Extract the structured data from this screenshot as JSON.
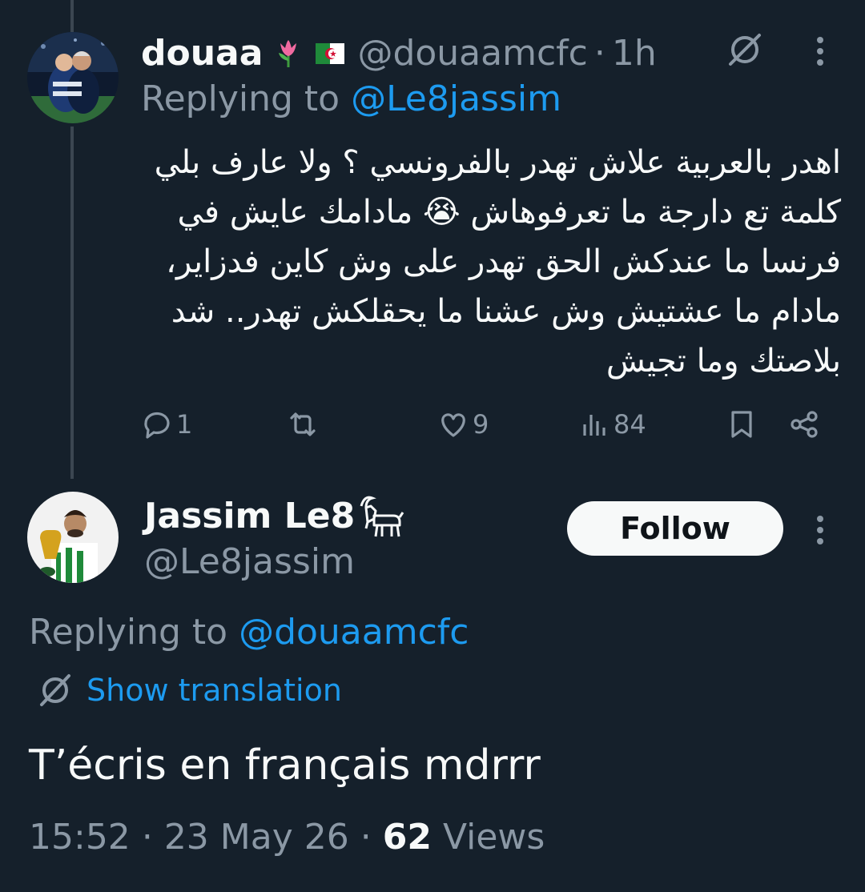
{
  "tweet1": {
    "display_name": "douaa",
    "emojis": [
      "tulip-emoji",
      "algeria-flag-emoji"
    ],
    "handle": "@douaamcfc",
    "separator": "·",
    "time": "1h",
    "replying_prefix": "Replying to",
    "replying_to": "@Le8jassim",
    "body_lines": [
      "اهدر بالعربية علاش تهدر بالفرونسي ؟ ولا عارف بلي",
      "كلمة تع دارجة ما تعرفوهاش 😭 مادامك عايش في",
      "فرنسا ما عندكش الحق تهدر على وش كاين فدزاير،",
      "مادام ما عشتيش وش عشنا ما يحقلكش تهدر.. شد",
      "بلاصتك وما تجيش"
    ],
    "actions": {
      "reply_count": "1",
      "retweet_count": "",
      "like_count": "9",
      "views_count": "84"
    }
  },
  "tweet2": {
    "display_name": "Jassim Le8",
    "name_icon": "goat-icon",
    "handle": "@Le8jassim",
    "follow_label": "Follow",
    "replying_prefix": "Replying to",
    "replying_to": "@douaamcfc",
    "show_translation": "Show translation",
    "body": "T’écris en français mdrrr",
    "time": "15:52",
    "date": "23 May 26",
    "separator": "·",
    "views_count": "62",
    "views_label": "Views"
  },
  "colors": {
    "background": "#15202b",
    "text": "#f7f9f9",
    "muted": "#8b98a5",
    "link": "#1d9bf0",
    "thread_line": "#3b4651"
  }
}
